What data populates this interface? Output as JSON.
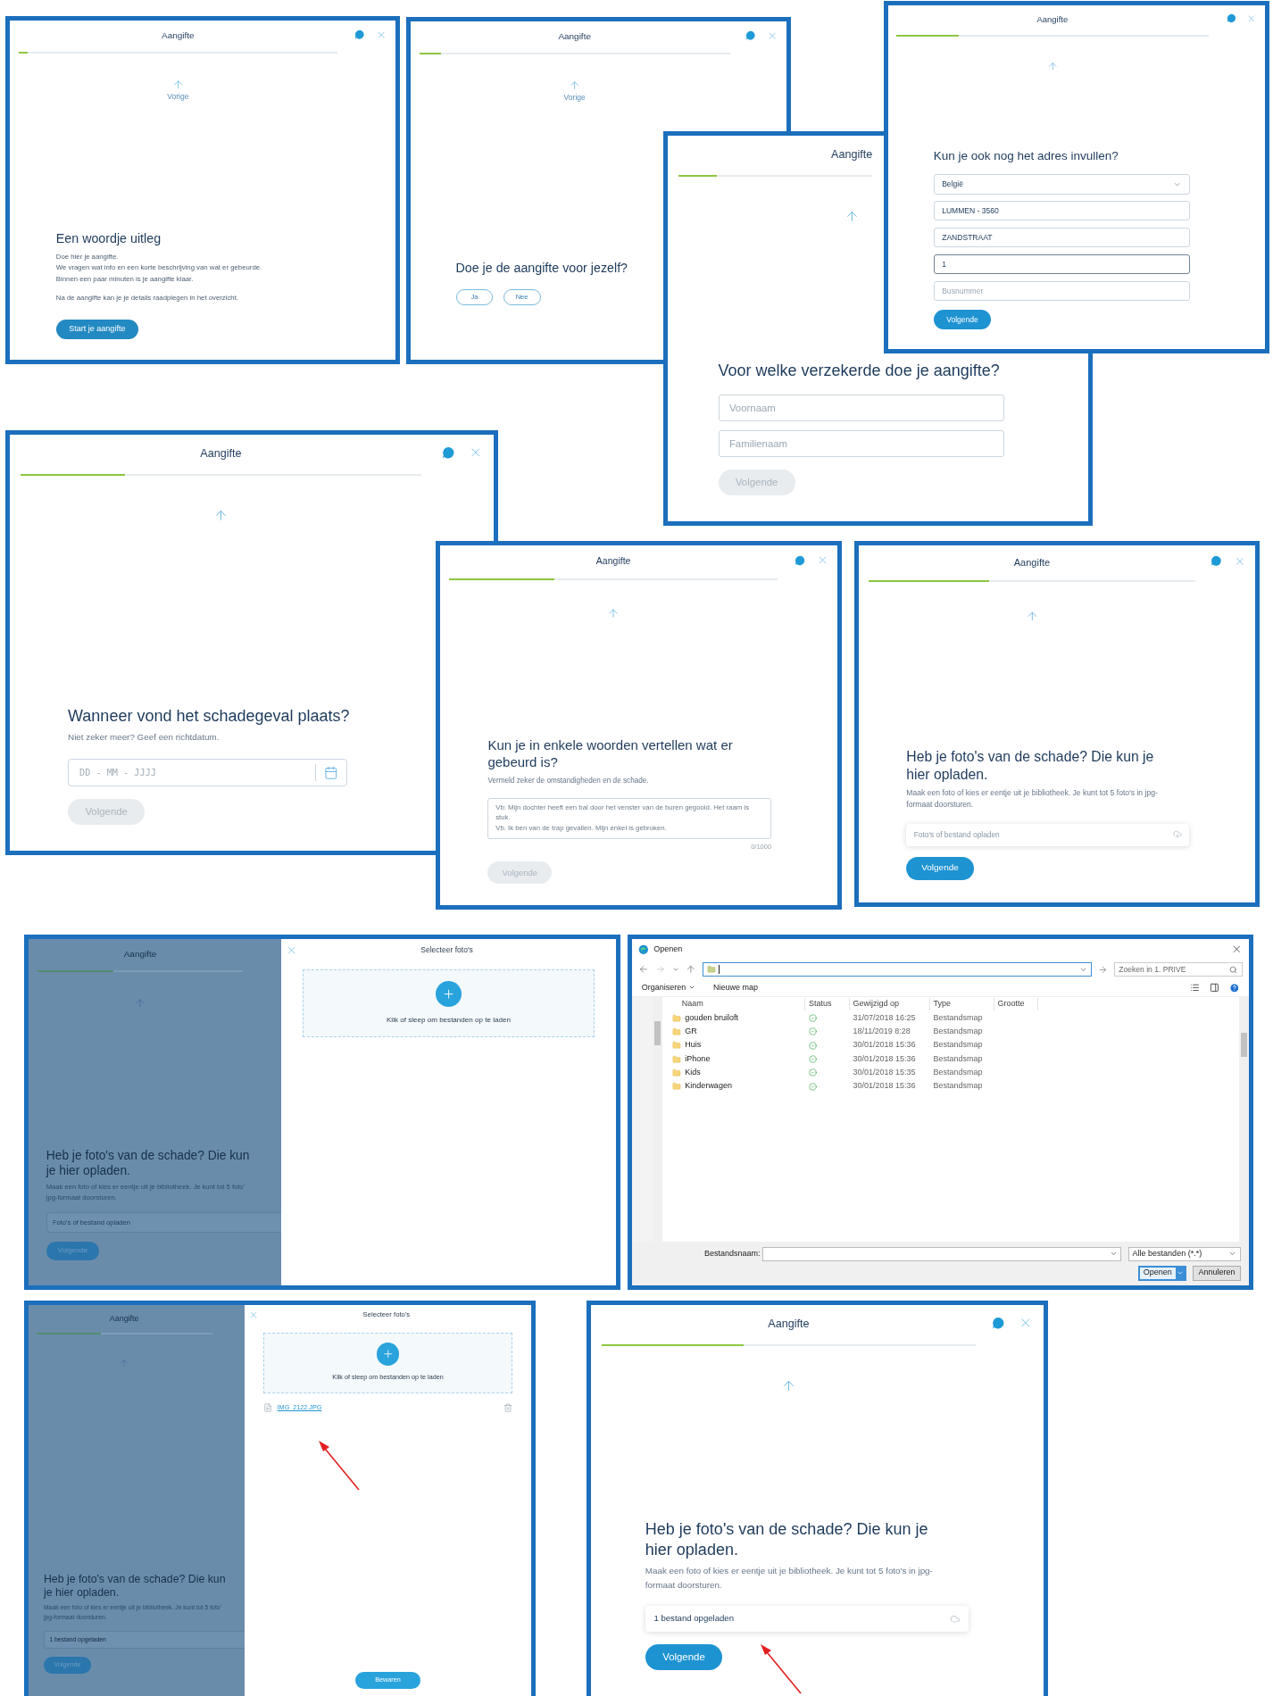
{
  "panels": [
    {
      "kind": "intro",
      "title": "Aangifte",
      "progress": {
        "level": 0.03
      },
      "back": "Vorige",
      "heading": "Een woordje uitleg",
      "lines": [
        "Doe hier je aangifte.",
        "We vragen wat info en een korte beschrijving van wat er gebeurde.",
        "Binnen een paar minuten is je aangifte klaar."
      ],
      "note": "Na de aangifte kan je je details raadplegen in het overzicht.",
      "button": {
        "label": "Start je aangifte",
        "disabled": false
      }
    },
    {
      "kind": "choice",
      "title": "Aangifte",
      "progress": {
        "level": 0.07
      },
      "back": "Vorige",
      "heading": "Doe je de aangifte voor jezelf?",
      "options": [
        {
          "label": "Ja",
          "selected": false
        },
        {
          "label": "Nee",
          "selected": false
        }
      ]
    },
    {
      "kind": "question",
      "title": "Aangifte",
      "progress": {
        "level": 0.2
      },
      "heading": "Voor welke verzekerde doe je aangifte?",
      "fields": [
        {
          "kind": "text",
          "placeholder": "Voornaam"
        },
        {
          "kind": "text",
          "placeholder": "Familienaam"
        }
      ],
      "button": {
        "label": "Volgende",
        "disabled": true
      }
    },
    {
      "kind": "question",
      "title": "Aangifte",
      "progress": {
        "level": 0.2
      },
      "heading": "Kun je ook nog het adres invullen?",
      "fields": [
        {
          "kind": "select",
          "value": "België",
          "focused": false
        },
        {
          "kind": "text",
          "value": "LUMMEN - 3560",
          "focused": false
        },
        {
          "kind": "text",
          "value": "ZANDSTRAAT",
          "focused": false
        },
        {
          "kind": "text",
          "value": "1",
          "focused": true
        },
        {
          "kind": "text",
          "placeholder": "Busnummer",
          "focused": false
        }
      ],
      "button": {
        "label": "Volgende",
        "disabled": false
      }
    },
    {
      "kind": "question",
      "title": "Aangifte",
      "progress": {
        "level": 0.26
      },
      "heading": "Wanneer vond het schadegeval plaats?",
      "subtitle": "Niet zeker meer? Geef een richtdatum.",
      "fields": [
        {
          "kind": "date",
          "placeholder": "DD - MM - JJJJ"
        }
      ],
      "button": {
        "label": "Volgende",
        "disabled": true
      }
    },
    {
      "kind": "question",
      "title": "Aangifte",
      "progress": {
        "level": 0.32
      },
      "heading": "Kun je in enkele woorden vertellen wat er gebeurd is?",
      "subtitle": "Vermeld zeker de omstandigheden en de schade.",
      "fields": [
        {
          "kind": "textarea",
          "placeholder": [
            "Vb: Mijn dochter heeft een bal door het venster van de buren gegooid. Het raam is stuk.",
            "Vb. Ik ben van de trap gevallen. Mijn enkel is gebroken."
          ],
          "counter": "0/1000"
        }
      ],
      "button": {
        "label": "Volgende",
        "disabled": true
      }
    },
    {
      "kind": "question",
      "title": "Aangifte",
      "progress": {
        "level": 0.37
      },
      "heading": "Heb je foto's van de schade? Die kun je hier opladen.",
      "subtitle": "Maak een foto of kies er eentje uit je bibliotheek. Je kunt tot 5 foto's in jpg-formaat doorsturen.",
      "fields": [
        {
          "kind": "upload",
          "placeholder": "Foto's of bestand opladen"
        }
      ],
      "button": {
        "label": "Volgende",
        "disabled": false
      }
    },
    {
      "kind": "drawer",
      "background": {
        "title": "Aangifte",
        "progress": {
          "level": 0.37
        },
        "heading": "Heb je foto's van de schade? Die kun je hier opladen.",
        "lines": [
          "Maak een foto of kies er eentje uit je bibliotheek. Je kunt tot 5 foto'",
          "jpg-formaat doorsturen."
        ],
        "field": {
          "placeholder": "Foto's of bestand opladen"
        },
        "button": "Volgende"
      },
      "drawer": {
        "title": "Selecteer foto's",
        "dropzone": "Klik of sleep om bestanden op te laden"
      }
    },
    {
      "kind": "dialog",
      "title": "Openen",
      "search": {
        "placeholder": "Zoeken in 1. PRIVE"
      },
      "toolbar": [
        "Organiseren",
        "Nieuwe map"
      ],
      "columns": [
        "Naam",
        "Status",
        "Gewijzigd op",
        "Type",
        "Grootte"
      ],
      "rows": [
        {
          "name": "gouden bruiloft",
          "modified": "31/07/2018 16:25",
          "type": "Bestandsmap"
        },
        {
          "name": "GR",
          "modified": "18/11/2019 8:28",
          "type": "Bestandsmap"
        },
        {
          "name": "Huis",
          "modified": "30/01/2018 15:36",
          "type": "Bestandsmap"
        },
        {
          "name": "iPhone",
          "modified": "30/01/2018 15:36",
          "type": "Bestandsmap"
        },
        {
          "name": "Kids",
          "modified": "30/01/2018 15:35",
          "type": "Bestandsmap"
        },
        {
          "name": "Kinderwagen",
          "modified": "30/01/2018 15:36",
          "type": "Bestandsmap"
        }
      ],
      "filename_label": "Bestandsnaam:",
      "filter": "Alle bestanden (*.*)",
      "buttons": [
        "Openen",
        "Annuleren"
      ]
    },
    {
      "kind": "drawer",
      "background": {
        "title": "Aangifte",
        "progress": {
          "level": 0.37
        },
        "heading": "Heb je foto's van de schade? Die kun je hier opladen.",
        "lines": [
          "Maak een foto of kies er eentje uit je bibliotheek. Je kunt tot 5 foto'",
          "jpg-formaat doorsturen."
        ],
        "field": {
          "value": "1 bestand opgeladen"
        },
        "button": "Volgende"
      },
      "drawer": {
        "title": "Selecteer foto's",
        "dropzone": "Klik of sleep om bestanden op te laden",
        "files": [
          {
            "name": "IMG_2122.JPG"
          }
        ],
        "save": "Bewaren"
      }
    },
    {
      "kind": "question",
      "title": "Aangifte",
      "progress": {
        "level": 0.38
      },
      "heading": "Heb je foto's van de schade? Die kun je hier opladen.",
      "subtitle": "Maak een foto of kies er eentje uit je bibliotheek. Je kunt tot 5 foto's in jpg-formaat doorsturen.",
      "fields": [
        {
          "kind": "upload",
          "value": "1 bestand opgeladen"
        }
      ],
      "button": {
        "label": "Volgende",
        "disabled": false
      }
    }
  ]
}
